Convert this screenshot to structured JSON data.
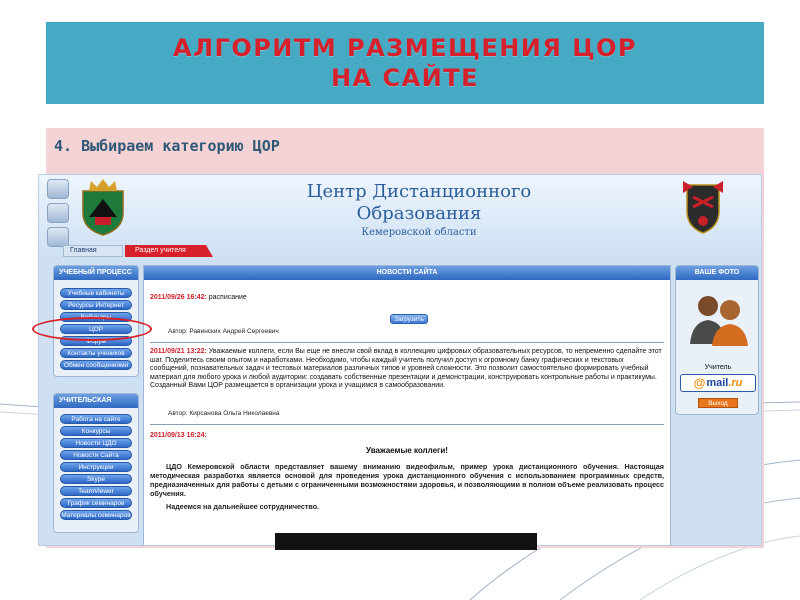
{
  "slide": {
    "title_line1": "АЛГОРИТМ РАЗМЕЩЕНИЯ ЦОР",
    "title_line2": "НА САЙТЕ",
    "step_text": "4. Выбираем категорию ЦОР"
  },
  "site": {
    "title_line1": "Центр Дистанционного",
    "title_line2": "Образования",
    "subtitle": "Кемеровской области",
    "nav": {
      "home": "Главная",
      "teacher_section": "Раздел учителя"
    }
  },
  "left_menu": {
    "process_title": "УЧЕБНЫЙ ПРОЦЕСС",
    "process_items": [
      "Учебные кабинеты",
      "Ресурсы Интернет",
      "Вебинары",
      "ЦОР",
      "Форум",
      "Контакты учеников",
      "Обмен сообщениями"
    ],
    "teacher_title": "УЧИТЕЛЬСКАЯ",
    "teacher_items": [
      "Работа на сайте",
      "Конкурсы",
      "Новости ЦДО",
      "Новости Сайта",
      "Инструкции",
      "Skype",
      "TeamViewer",
      "График семинаров",
      "Материалы семинаров"
    ]
  },
  "news": {
    "header": "НОВОСТИ САЙТА",
    "item1": {
      "date": "2011/09/26 16:42:",
      "text": " расписание",
      "button": "Загрузить",
      "author": "Автор: Равинских Андрей Сергеевич"
    },
    "item2": {
      "date": "2011/09/21 13:22:",
      "text": " Уважаемые коллеги, если Вы еще не внесли свой вклад в коллекцию цифровых образовательных ресурсов, то непременно сделайте этот шаг. Поделитесь своим опытом и наработками. Необходимо, чтобы каждый учитель получил доступ к огромному банку графических и текстовых сообщений, познавательных задач и тестовых материалов различных типов и уровней сложности. Это позволит самостоятельно формировать учебный материал для любого урока и любой аудитории: создавать собственные презентации и демонстрации, конструировать контрольные работы и практикумы. Созданный Вами ЦОР размещается в организации урока и учащимся в самообразовании.",
      "author": "Автор: Кирсанова Ольга Николаевна"
    },
    "item3": {
      "date": "2011/09/13 16:24:",
      "title": "Уважаемые коллеги!",
      "body": "ЦДО Кемеровской области представляет вашему вниманию видеофильм, пример урока дистанционного обучения. Настоящая методическая разработка является основой для проведения урока дистанционного обучения с использованием программных средств, предназначенных для работы с детьми с ограниченными возможностями здоровья, и позволяющими в полном объеме реализовать процесс обучения.",
      "closing": "Надеемся на дальнейшее сотрудничество."
    }
  },
  "right_panel": {
    "header": "ВАШЕ ФОТО",
    "label": "Учитель",
    "mail_at": "@",
    "mail_word": "mail",
    "mail_ru": ".ru",
    "login_button": "Выход"
  },
  "colors": {
    "title_bg": "#46aac4",
    "title_text": "#d6212c",
    "panel_bg": "#f4d3d6",
    "highlight": "#d81f26"
  }
}
